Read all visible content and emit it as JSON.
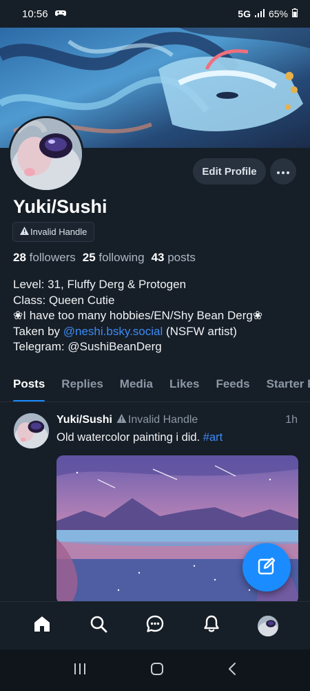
{
  "status_bar": {
    "time": "10:56",
    "network": "5G",
    "battery": "65%"
  },
  "profile": {
    "display_name": "Yuki/Sushi",
    "handle_badge": "Invalid Handle",
    "edit_button": "Edit Profile",
    "followers_count": "28",
    "followers_label": "followers",
    "following_count": "25",
    "following_label": "following",
    "posts_count": "43",
    "posts_label": "posts",
    "bio": {
      "line1": "Level: 31, Fluffy Derg & Protogen",
      "line2": "Class: Queen Cutie",
      "line3": "❀I have too many hobbies/EN/Shy Bean Derg❀",
      "line4_prefix": "Taken by ",
      "line4_link": "@neshi.bsky.social",
      "line4_suffix": " (NSFW artist)",
      "line5": "Telegram: @SushiBeanDerg"
    }
  },
  "tabs": [
    "Posts",
    "Replies",
    "Media",
    "Likes",
    "Feeds",
    "Starter Packs"
  ],
  "post": {
    "author": "Yuki/Sushi",
    "handle": "Invalid Handle",
    "time": "1h",
    "text": "Old watercolor painting i did. ",
    "hashtag": "#art"
  },
  "colors": {
    "background": "#161e27",
    "accent": "#1a8cff",
    "link": "#3d8bf5",
    "muted": "#8c98a6"
  },
  "icons": {
    "status": [
      "game-controller-icon",
      "signal-icon",
      "battery-icon"
    ],
    "bottom_nav": [
      "home-icon",
      "search-icon",
      "chat-icon",
      "bell-icon",
      "profile-avatar"
    ],
    "fab": "compose-icon",
    "android_nav": [
      "recents-icon",
      "home-circle-icon",
      "back-icon"
    ]
  }
}
